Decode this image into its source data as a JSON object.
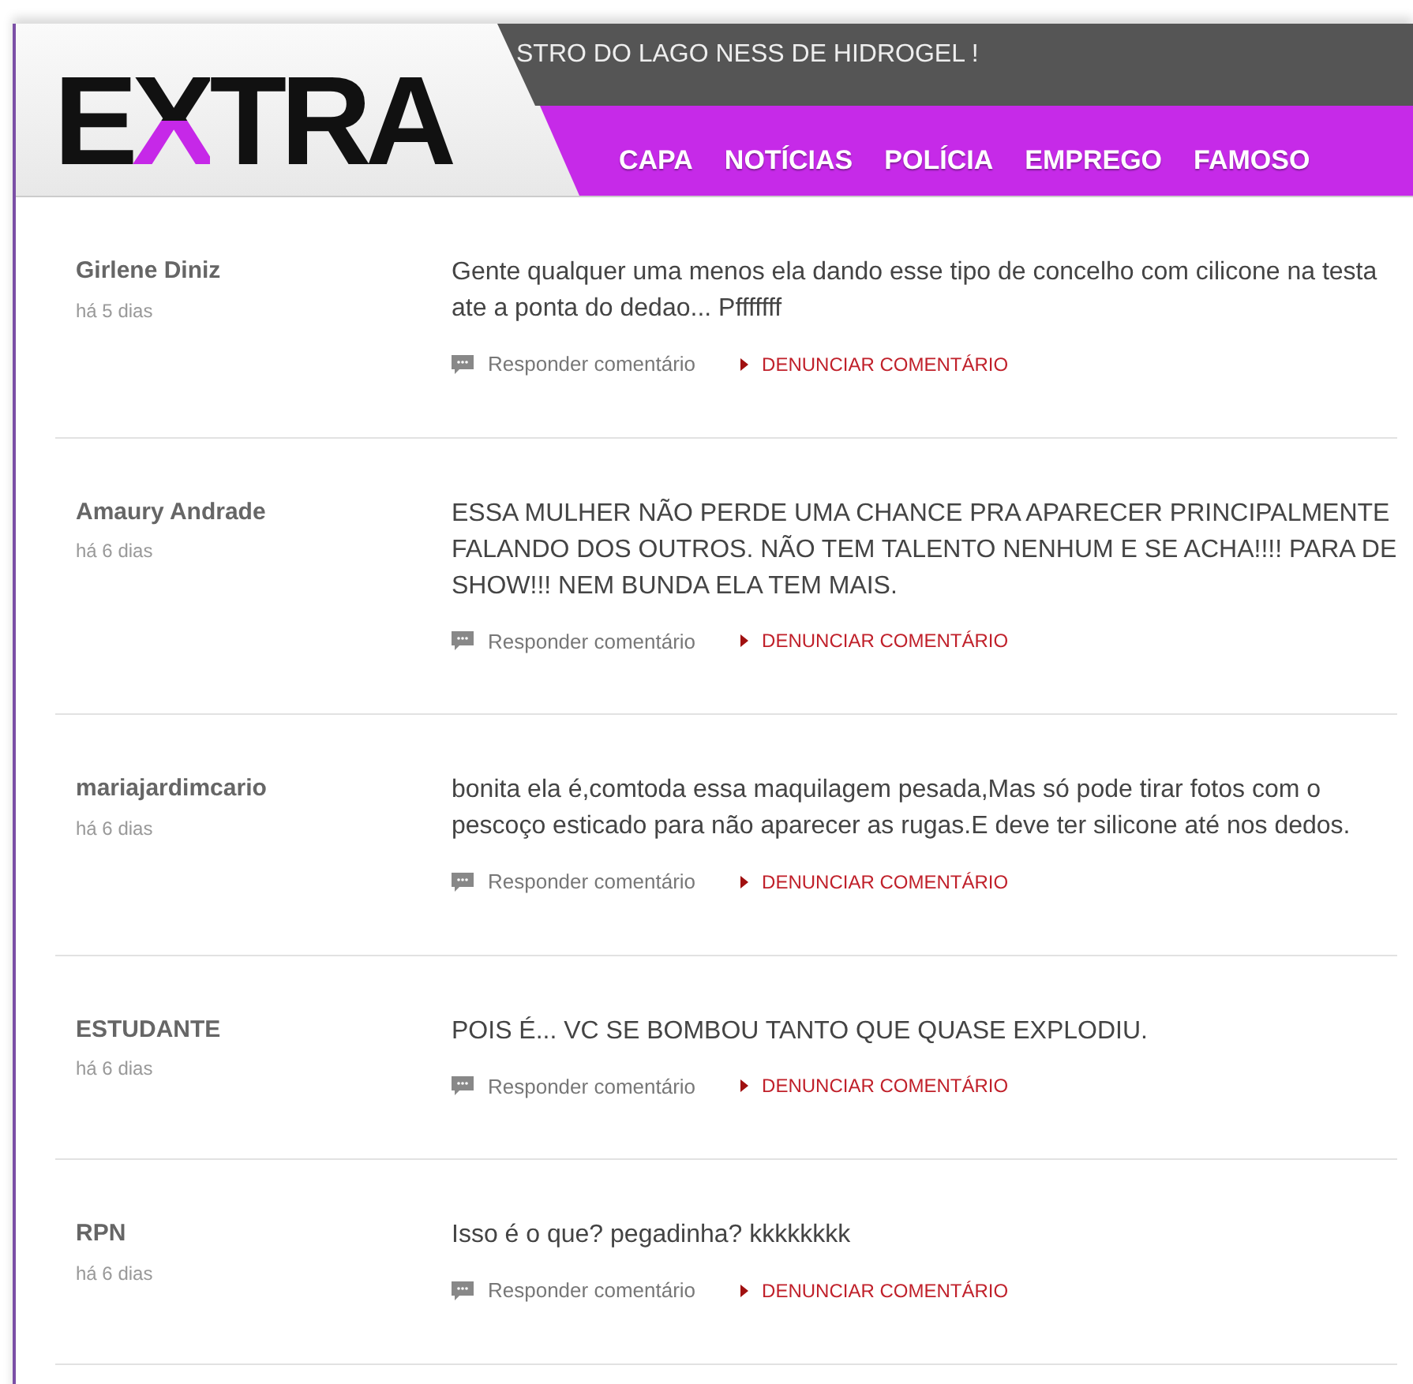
{
  "header": {
    "logo": "EXTRA",
    "ticker": "STRO DO LAGO NESS DE HIDROGEL !",
    "nav": [
      "CAPA",
      "NOTÍCIAS",
      "POLÍCIA",
      "EMPREGO",
      "FAMOSO"
    ]
  },
  "comments": [
    {
      "author": "Girlene Diniz",
      "time": "há 5 dias",
      "text": "Gente qualquer uma menos ela dando esse tipo de concelho com cilicone na testa ate a ponta do dedao... Pfffffff",
      "reply": "Responder comentário",
      "report": "DENUNCIAR COMENTÁRIO"
    },
    {
      "author": "Amaury Andrade",
      "time": "há 6 dias",
      "text": "ESSA MULHER NÃO PERDE UMA CHANCE PRA APARECER PRINCIPALMENTE FALANDO DOS OUTROS. NÃO TEM TALENTO NENHUM E SE ACHA!!!! PARA DE SHOW!!! NEM BUNDA ELA TEM MAIS.",
      "reply": "Responder comentário",
      "report": "DENUNCIAR COMENTÁRIO"
    },
    {
      "author": "mariajardimcario",
      "time": "há 6 dias",
      "text": "bonita ela é,comtoda essa maquilagem pesada,Mas só pode tirar fotos com o pescoço esticado para não aparecer as rugas.E deve ter silicone até nos dedos.",
      "reply": "Responder comentário",
      "report": "DENUNCIAR COMENTÁRIO"
    },
    {
      "author": "ESTUDANTE",
      "time": "há 6 dias",
      "text": "POIS É... VC SE BOMBOU TANTO QUE QUASE EXPLODIU.",
      "reply": "Responder comentário",
      "report": "DENUNCIAR COMENTÁRIO"
    },
    {
      "author": "RPN",
      "time": "há 6 dias",
      "text": "Isso é o que? pegadinha? kkkkkkkk",
      "reply": "Responder comentário",
      "report": "DENUNCIAR COMENTÁRIO"
    }
  ]
}
